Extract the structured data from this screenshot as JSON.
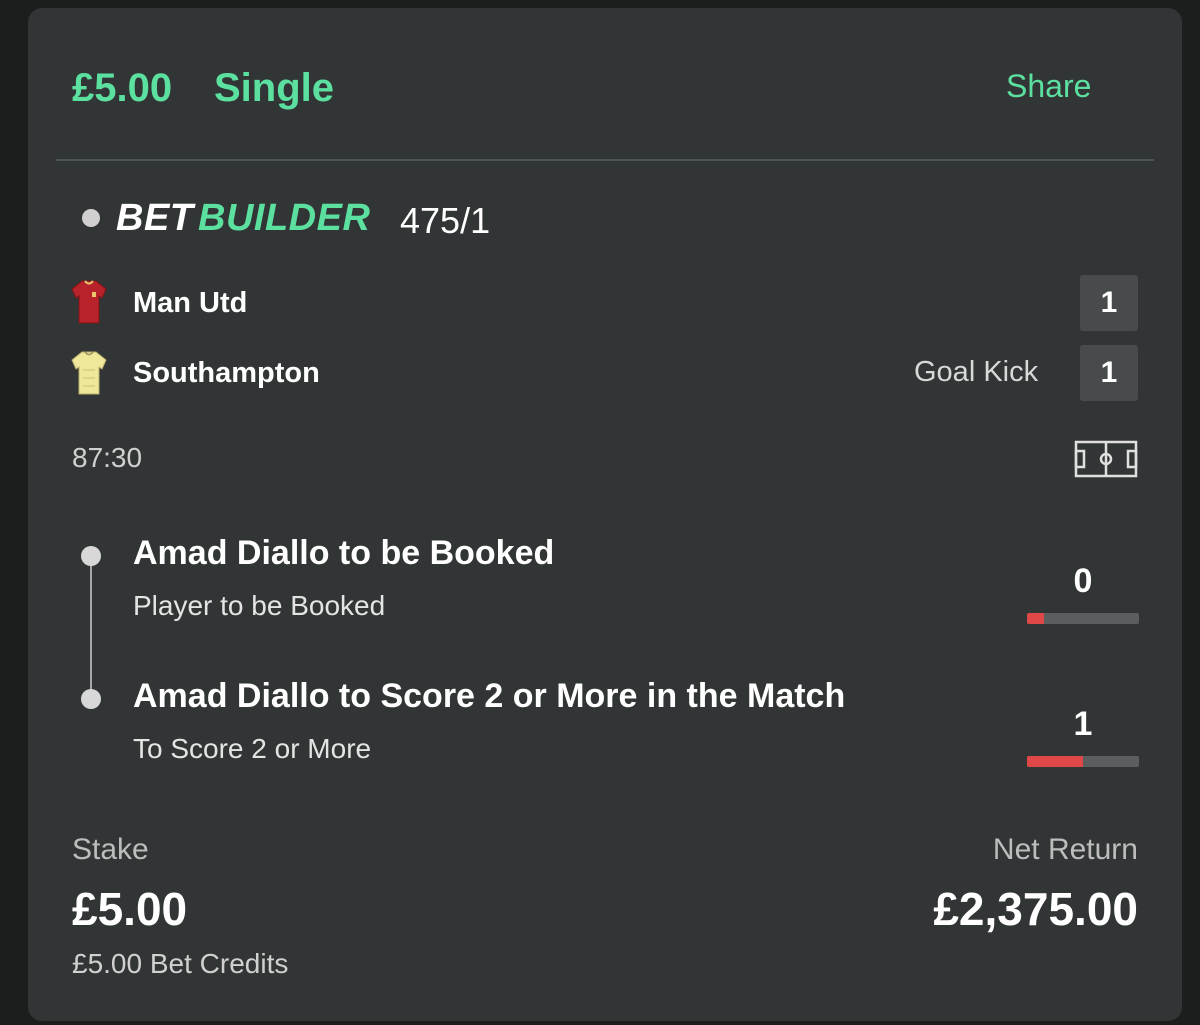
{
  "header": {
    "amount": "£5.00",
    "bet_type": "Single",
    "share_label": "Share"
  },
  "bet_builder": {
    "bet_text": "BET",
    "builder_text": "BUILDER",
    "odds": "475/1"
  },
  "match": {
    "home": {
      "name": "Man Utd",
      "score": "1",
      "shirt_icon": "red-shirt-icon",
      "shirt_color": "#b8222a"
    },
    "away": {
      "name": "Southampton",
      "score": "1",
      "shirt_icon": "yellow-shirt-icon",
      "shirt_color": "#efe79a",
      "event": "Goal Kick"
    },
    "time": "87:30",
    "pitch_icon": "pitch-icon"
  },
  "selections": [
    {
      "title": "Amad Diallo to be Booked",
      "subtitle": "Player to be Booked",
      "progress_value": "0",
      "progress_fraction": 0.15
    },
    {
      "title": "Amad Diallo to Score 2 or More in the Match",
      "subtitle": "To Score 2 or More",
      "progress_value": "1",
      "progress_fraction": 0.5
    }
  ],
  "footer": {
    "stake_label": "Stake",
    "stake_value": "£5.00",
    "credits": "£5.00 Bet Credits",
    "net_return_label": "Net Return",
    "net_return_value": "£2,375.00"
  },
  "colors": {
    "accent": "#5ce0a0",
    "card_background": "#323535",
    "progress_fill": "#e04848"
  }
}
